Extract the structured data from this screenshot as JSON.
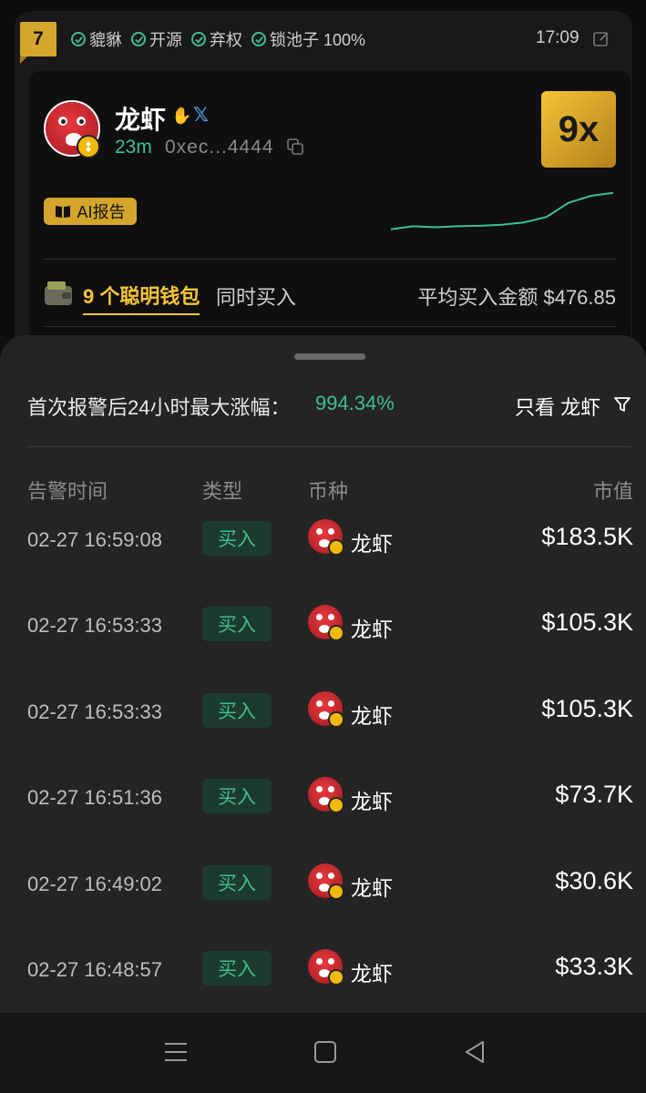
{
  "header": {
    "rank": "7",
    "checks": [
      "貔貅",
      "开源",
      "弃权",
      "锁池子 100%"
    ],
    "time": "17:09"
  },
  "token": {
    "name": "龙虾",
    "age": "23m",
    "address": "0xec...4444",
    "multiplier": "9x",
    "ai_report_label": "AI报告",
    "smart_wallets": "9 个聪明钱包",
    "buy_together": "同时买入",
    "avg_buy": "平均买入金额 $476.85",
    "sparkline": [
      0.08,
      0.14,
      0.12,
      0.14,
      0.15,
      0.17,
      0.22,
      0.33,
      0.62,
      0.76,
      0.82
    ]
  },
  "sheet": {
    "gain_label": "首次报警后24小时最大涨幅：",
    "gain_value": "994.34%",
    "filter_label": "只看 龙虾",
    "columns": [
      "告警时间",
      "类型",
      "币种",
      "市值"
    ],
    "rows": [
      {
        "time": "02-27 16:59:08",
        "type": "买入",
        "coin": "龙虾",
        "mcap": "$183.5K"
      },
      {
        "time": "02-27 16:53:33",
        "type": "买入",
        "coin": "龙虾",
        "mcap": "$105.3K"
      },
      {
        "time": "02-27 16:53:33",
        "type": "买入",
        "coin": "龙虾",
        "mcap": "$105.3K"
      },
      {
        "time": "02-27 16:51:36",
        "type": "买入",
        "coin": "龙虾",
        "mcap": "$73.7K"
      },
      {
        "time": "02-27 16:49:02",
        "type": "买入",
        "coin": "龙虾",
        "mcap": "$30.6K"
      },
      {
        "time": "02-27 16:48:57",
        "type": "买入",
        "coin": "龙虾",
        "mcap": "$33.3K"
      }
    ]
  },
  "nav": {
    "icons": [
      "menu-icon",
      "home-square-icon",
      "back-triangle-icon"
    ]
  },
  "colors": {
    "accent_green": "#3fbf8f",
    "gold": "#f5c437",
    "sheet_bg": "#242424"
  }
}
